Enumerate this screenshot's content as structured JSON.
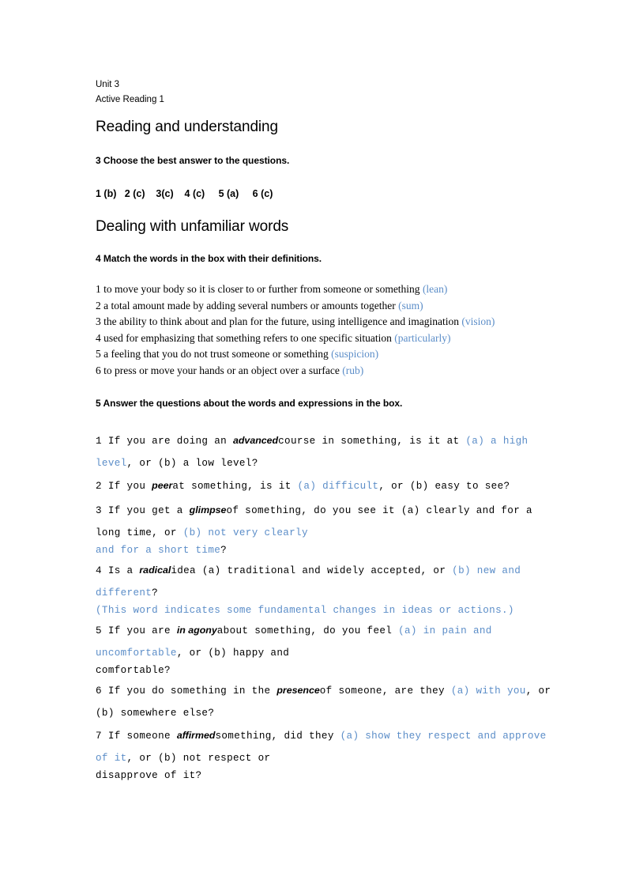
{
  "accent_blue": "#5b8dc8",
  "header": {
    "unit": "Unit 3",
    "book": "Active Reading 1"
  },
  "sections": [
    {
      "heading": "Reading and understanding",
      "instruction": "3 Choose the best answer to the questions.",
      "answer_row": "1 (b)   2 (c)    3(c)    4 (c)     5 (a)     6 (c)",
      "answers": [
        {
          "number": "1",
          "choice": "(b)"
        },
        {
          "number": "2",
          "choice": "(c)"
        },
        {
          "number": "3",
          "choice": "(c)"
        },
        {
          "number": "4",
          "choice": "(c)"
        },
        {
          "number": "5",
          "choice": "(a)"
        },
        {
          "number": "6",
          "choice": "(c)"
        }
      ]
    },
    {
      "heading": "Dealing with unfamiliar words",
      "instruction": "4 Match the words in the box with their definitions.",
      "definitions": [
        {
          "number": "1",
          "text": "to move your body so it is closer to or further from someone or something",
          "answer": "(lean)"
        },
        {
          "number": "2",
          "text": "a total amount made by adding several numbers or amounts together",
          "answer": "(sum)"
        },
        {
          "number": "3",
          "text": "the ability to think about and plan for the future, using intelligence and imagination",
          "answer": "(vision)"
        },
        {
          "number": "4",
          "text": "used for emphasizing that something refers to one specific situation",
          "answer": "(particularly)"
        },
        {
          "number": "5",
          "text": "a feeling that you do not trust someone or something",
          "answer": "(suspicion)"
        },
        {
          "number": "6",
          "text": "to press or move your hands or an object over a surface",
          "answer": "(rub)"
        }
      ]
    }
  ],
  "exercise5": {
    "instruction": "5 Answer the questions about the words and expressions in the box.",
    "items": [
      {
        "number": "1",
        "keyword": "advanced",
        "lines": [
          {
            "leading": "lead",
            "segments": [
              {
                "t": "1 If you are doing an ",
                "s": "mono"
              },
              {
                "t": "advanced",
                "s": "kw"
              },
              {
                "t": "course in something, is it at ",
                "s": "mono"
              },
              {
                "t": "(a) a high",
                "s": "blue"
              }
            ]
          },
          {
            "leading": "cont",
            "segments": [
              {
                "t": "level",
                "s": "blue"
              },
              {
                "t": ", or (b) a low level?",
                "s": "mono"
              }
            ]
          }
        ]
      },
      {
        "number": "2",
        "keyword": "peer",
        "lines": [
          {
            "leading": "lead",
            "segments": [
              {
                "t": "2 If you ",
                "s": "mono"
              },
              {
                "t": "peer",
                "s": "kw"
              },
              {
                "t": "at something, is it ",
                "s": "mono"
              },
              {
                "t": "(a) difficult",
                "s": "blue"
              },
              {
                "t": ", or (b) easy to see?",
                "s": "mono"
              }
            ]
          }
        ]
      },
      {
        "number": "3",
        "keyword": "glimpse",
        "lines": [
          {
            "leading": "lead",
            "segments": [
              {
                "t": "3 If you get a ",
                "s": "mono"
              },
              {
                "t": "glimpse",
                "s": "kw"
              },
              {
                "t": "of something, do you see it (a) clearly and for a",
                "s": "mono"
              }
            ]
          },
          {
            "leading": "cont",
            "segments": [
              {
                "t": "long time, or ",
                "s": "mono"
              },
              {
                "t": "(b) not very clearly",
                "s": "blue"
              }
            ]
          },
          {
            "leading": "cont-tight",
            "segments": [
              {
                "t": "and for a short time",
                "s": "blue"
              },
              {
                "t": "?",
                "s": "mono"
              }
            ]
          }
        ]
      },
      {
        "number": "4",
        "keyword": "radical",
        "lines": [
          {
            "leading": "lead",
            "segments": [
              {
                "t": "4 Is a ",
                "s": "mono"
              },
              {
                "t": "radical",
                "s": "kw"
              },
              {
                "t": "idea (a) traditional and widely accepted, or ",
                "s": "mono"
              },
              {
                "t": "(b) new and",
                "s": "blue"
              }
            ]
          },
          {
            "leading": "cont",
            "segments": [
              {
                "t": "different",
                "s": "blue"
              },
              {
                "t": "?",
                "s": "mono"
              }
            ]
          },
          {
            "leading": "cont-tight",
            "segments": [
              {
                "t": "(This word indicates some fundamental changes in ideas or actions.)",
                "s": "blue"
              }
            ]
          }
        ]
      },
      {
        "number": "5",
        "keyword": "in agony",
        "lines": [
          {
            "leading": "lead",
            "segments": [
              {
                "t": "5 If you are ",
                "s": "mono"
              },
              {
                "t": "in agony",
                "s": "kw"
              },
              {
                "t": "about something, do you feel ",
                "s": "mono"
              },
              {
                "t": "(a) in pain and",
                "s": "blue"
              }
            ]
          },
          {
            "leading": "cont",
            "segments": [
              {
                "t": "uncomfortable",
                "s": "blue"
              },
              {
                "t": ", or (b) happy and",
                "s": "mono"
              }
            ]
          },
          {
            "leading": "cont-tight",
            "segments": [
              {
                "t": "comfortable?",
                "s": "mono"
              }
            ]
          }
        ]
      },
      {
        "number": "6",
        "keyword": "presence",
        "lines": [
          {
            "leading": "lead",
            "segments": [
              {
                "t": "6 If you do something in the ",
                "s": "mono"
              },
              {
                "t": "presence",
                "s": "kw"
              },
              {
                "t": "of someone, are they ",
                "s": "mono"
              },
              {
                "t": "(a) with you",
                "s": "blue"
              },
              {
                "t": ", or",
                "s": "mono"
              }
            ]
          },
          {
            "leading": "cont",
            "segments": [
              {
                "t": "(b) somewhere else?",
                "s": "mono"
              }
            ]
          }
        ]
      },
      {
        "number": "7",
        "keyword": "affirmed",
        "lines": [
          {
            "leading": "lead",
            "segments": [
              {
                "t": "7 If someone ",
                "s": "mono"
              },
              {
                "t": "affirmed",
                "s": "kw"
              },
              {
                "t": "something, did they ",
                "s": "mono"
              },
              {
                "t": "(a) show they respect and approve",
                "s": "blue"
              }
            ]
          },
          {
            "leading": "cont",
            "segments": [
              {
                "t": "of it",
                "s": "blue"
              },
              {
                "t": ", or (b) not respect or",
                "s": "mono"
              }
            ]
          },
          {
            "leading": "cont-tight",
            "segments": [
              {
                "t": "disapprove of it?",
                "s": "mono"
              }
            ]
          }
        ]
      }
    ]
  }
}
